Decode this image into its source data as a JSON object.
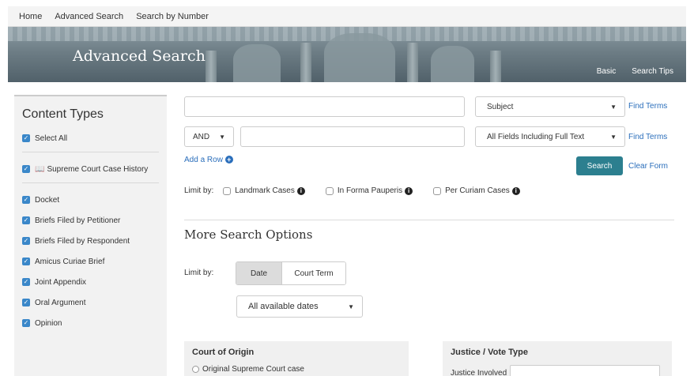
{
  "nav": {
    "items": [
      "Home",
      "Advanced Search",
      "Search by Number"
    ]
  },
  "banner": {
    "title": "Advanced Search",
    "links": [
      "Basic",
      "Search Tips"
    ]
  },
  "sidebar": {
    "title": "Content Types",
    "select_all": "Select All",
    "history": "Supreme Court Case History",
    "types": [
      "Docket",
      "Briefs Filed by Petitioner",
      "Briefs Filed by Respondent",
      "Amicus Curiae Brief",
      "Joint Appendix",
      "Oral Argument",
      "Opinion"
    ]
  },
  "search": {
    "field1_select": "Subject",
    "find_terms": "Find Terms",
    "operator": "AND",
    "field2_select": "All Fields Including Full Text",
    "add_row": "Add a Row",
    "search_button": "Search",
    "clear_form": "Clear Form"
  },
  "limit": {
    "label": "Limit by:",
    "options": [
      "Landmark Cases",
      "In Forma Pauperis",
      "Per Curiam Cases"
    ]
  },
  "more": {
    "title": "More Search Options",
    "limit_label": "Limit by:",
    "tab_date": "Date",
    "tab_term": "Court Term",
    "date_select": "All available dates"
  },
  "court": {
    "title": "Court of Origin",
    "option1": "Original Supreme Court case"
  },
  "justice": {
    "title": "Justice / Vote Type",
    "involved_label": "Justice Involved"
  },
  "colors": {
    "accent": "#2c7f8f",
    "link": "#2a6ebb",
    "checkbox": "#3a87c9"
  }
}
